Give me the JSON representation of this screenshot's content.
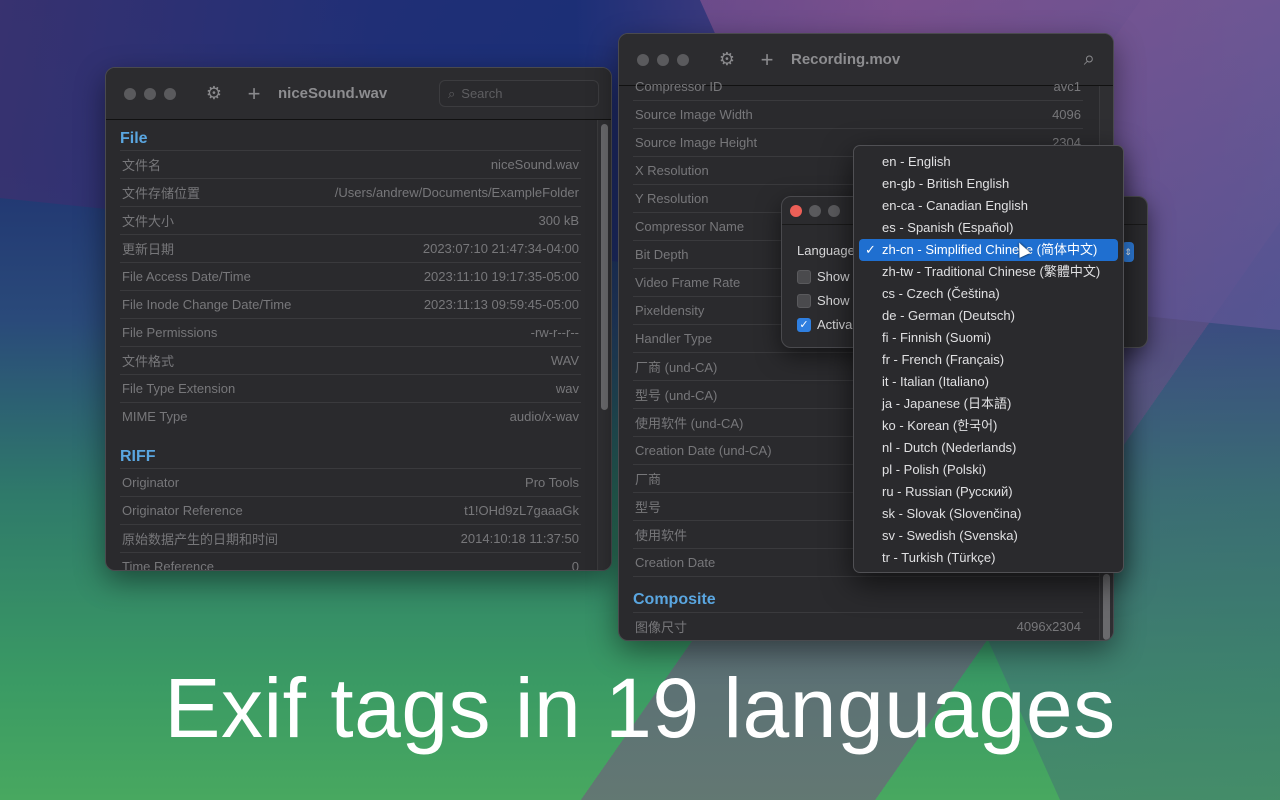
{
  "left_window": {
    "title": "niceSound.wav",
    "search_placeholder": "Search",
    "sections": [
      {
        "name": "File",
        "rows": [
          {
            "label": "文件名",
            "value": "niceSound.wav"
          },
          {
            "label": "文件存储位置",
            "value": "/Users/andrew/Documents/ExampleFolder"
          },
          {
            "label": "文件大小",
            "value": "300 kB"
          },
          {
            "label": "更新日期",
            "value": "2023:07:10 21:47:34-04:00"
          },
          {
            "label": "File Access Date/Time",
            "value": "2023:11:10 19:17:35-05:00"
          },
          {
            "label": "File Inode Change Date/Time",
            "value": "2023:11:13 09:59:45-05:00"
          },
          {
            "label": "File Permissions",
            "value": "-rw-r--r--"
          },
          {
            "label": "文件格式",
            "value": "WAV"
          },
          {
            "label": "File Type Extension",
            "value": "wav"
          },
          {
            "label": "MIME Type",
            "value": "audio/x-wav"
          }
        ]
      },
      {
        "name": "RIFF",
        "rows": [
          {
            "label": "Originator",
            "value": "Pro Tools"
          },
          {
            "label": "Originator Reference",
            "value": "t1!OHd9zL7gaaaGk"
          },
          {
            "label": "原始数据产生的日期和时间",
            "value": "2014:10:18 11:37:50"
          },
          {
            "label": "Time Reference",
            "value": "0"
          }
        ]
      }
    ]
  },
  "right_window": {
    "title": "Recording.mov",
    "rows": [
      {
        "label": "Compressor ID",
        "value": "avc1"
      },
      {
        "label": "Source Image Width",
        "value": "4096"
      },
      {
        "label": "Source Image Height",
        "value": "2304"
      },
      {
        "label": "X Resolution",
        "value": ""
      },
      {
        "label": "Y Resolution",
        "value": ""
      },
      {
        "label": "Compressor Name",
        "value": ""
      },
      {
        "label": "Bit Depth",
        "value": ""
      },
      {
        "label": "Video Frame Rate",
        "value": ""
      },
      {
        "label": "Pixeldensity",
        "value": ""
      },
      {
        "label": "Handler Type",
        "value": ""
      },
      {
        "label": "厂商 (und-CA)",
        "value": ""
      },
      {
        "label": "型号 (und-CA)",
        "value": ""
      },
      {
        "label": "使用软件 (und-CA)",
        "value": ""
      },
      {
        "label": "Creation Date (und-CA)",
        "value": ""
      },
      {
        "label": "厂商",
        "value": ""
      },
      {
        "label": "型号",
        "value": ""
      },
      {
        "label": "使用软件",
        "value": ""
      },
      {
        "label": "Creation Date",
        "value": ""
      }
    ],
    "composite": {
      "name": "Composite",
      "rows": [
        {
          "label": "图像尺寸",
          "value": "4096x2304"
        }
      ]
    }
  },
  "settings_dialog": {
    "language_label": "Language",
    "checkboxes": [
      {
        "label": "Show",
        "checked": false
      },
      {
        "label": "Show",
        "checked": false
      },
      {
        "label": "Activa",
        "checked": true
      }
    ]
  },
  "language_menu": {
    "selected_index": 4,
    "items": [
      "en - English",
      "en-gb - British English",
      "en-ca - Canadian English",
      "es - Spanish (Español)",
      "zh-cn - Simplified Chinese (简体中文)",
      "zh-tw - Traditional Chinese (繁體中文)",
      "cs - Czech (Čeština)",
      "de - German (Deutsch)",
      "fi - Finnish (Suomi)",
      "fr - French (Français)",
      "it - Italian (Italiano)",
      "ja - Japanese (日本語)",
      "ko - Korean (한국어)",
      "nl - Dutch (Nederlands)",
      "pl - Polish (Polski)",
      "ru - Russian (Русский)",
      "sk - Slovak (Slovenčina)",
      "sv - Swedish (Svenska)",
      "tr - Turkish (Türkçe)"
    ]
  },
  "headline": "Exif tags in 19 languages",
  "colors": {
    "section_heading": "#5aa6e0",
    "selection": "#1f6fd0",
    "close_button": "#ec5f57"
  }
}
